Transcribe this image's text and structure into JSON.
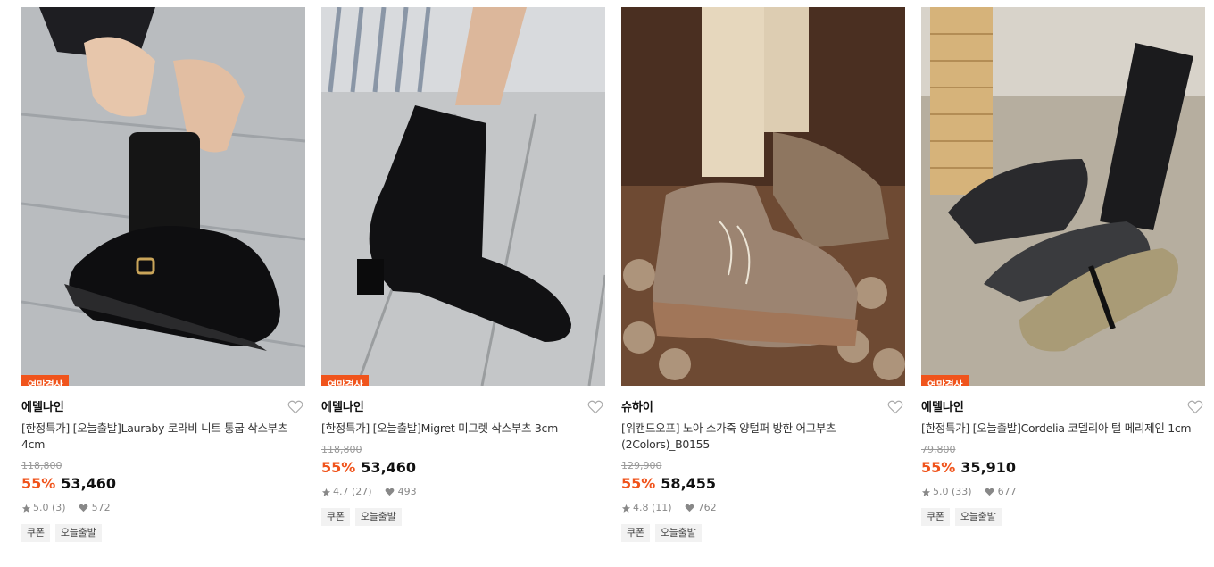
{
  "products": [
    {
      "badge": "연말결산",
      "brand": "에델나인",
      "name": "[한정특가] [오늘출발]Lauraby 로라비 니트 통굽 삭스부츠 4cm",
      "original_price": "118,800",
      "discount": "55%",
      "price": "53,460",
      "rating": "5.0 (3)",
      "likes": "572",
      "tags": [
        "쿠폰",
        "오늘출발"
      ],
      "image_icon": "black-loafer-with-socks-photo"
    },
    {
      "badge": "연말결산",
      "brand": "에델나인",
      "name": "[한정특가] [오늘출발]Migret 미그렛 삭스부츠 3cm",
      "original_price": "118,800",
      "discount": "55%",
      "price": "53,460",
      "rating": "4.7 (27)",
      "likes": "493",
      "tags": [
        "쿠폰",
        "오늘출발"
      ],
      "image_icon": "black-sock-boot-photo"
    },
    {
      "badge": "",
      "brand": "슈하이",
      "name": "[위캔드오프] 노아 소가죽 양털퍼 방한 어그부츠 (2Colors)_B0155",
      "original_price": "129,900",
      "discount": "55%",
      "price": "58,455",
      "rating": "4.8 (11)",
      "likes": "762",
      "tags": [
        "쿠폰",
        "오늘출발"
      ],
      "image_icon": "suede-fur-boots-photo"
    },
    {
      "badge": "연말결산",
      "brand": "에델나인",
      "name": "[한정특가] [오늘출발]Cordelia 코델리아 털 메리제인 1cm",
      "original_price": "79,800",
      "discount": "55%",
      "price": "35,910",
      "rating": "5.0 (33)",
      "likes": "677",
      "tags": [
        "쿠폰",
        "오늘출발"
      ],
      "image_icon": "mary-jane-flats-photo"
    }
  ],
  "colors": {
    "accent": "#f0541c",
    "badge_bg": "#f0541c",
    "tag_bg": "#f2f2f2"
  }
}
